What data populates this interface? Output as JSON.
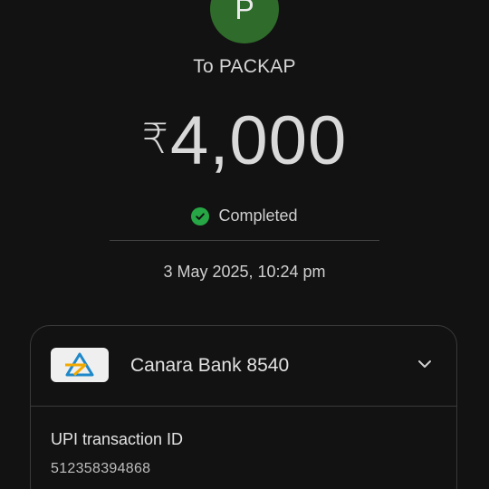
{
  "payee": {
    "avatar_letter": "P",
    "avatar_color": "#2f6b2a",
    "name_line": "To PACKAP"
  },
  "payment": {
    "currency_symbol": "₹",
    "amount": "4,000",
    "status": "Completed",
    "status_color": "#26a644",
    "status_icon": "check-circle-icon",
    "datetime": "3 May 2025, 10:24 pm"
  },
  "account_card": {
    "bank_name": "Canara Bank 8540",
    "bank_logo_icon": "canara-bank-logo",
    "expand_icon": "chevron-down-icon",
    "upi_label": "UPI transaction ID",
    "upi_id": "512358394868"
  }
}
